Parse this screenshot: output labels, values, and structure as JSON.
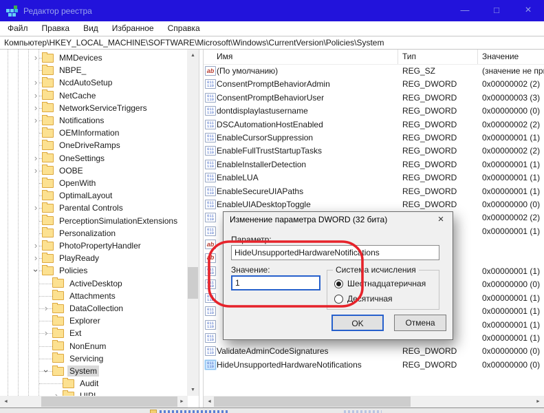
{
  "window": {
    "title": "Редактор реестра",
    "controls": [
      {
        "name": "minimize",
        "glyph": "—"
      },
      {
        "name": "maximize",
        "glyph": "□"
      },
      {
        "name": "close",
        "glyph": "×"
      }
    ]
  },
  "menu": {
    "items": [
      "Файл",
      "Правка",
      "Вид",
      "Избранное",
      "Справка"
    ]
  },
  "address": {
    "value": "Компьютер\\HKEY_LOCAL_MACHINE\\SOFTWARE\\Microsoft\\Windows\\CurrentVersion\\Policies\\System"
  },
  "tree": {
    "items": [
      {
        "label": "MMDevices",
        "level": 0,
        "expander": "collapsed",
        "selected": false
      },
      {
        "label": "NBPE_",
        "level": 0,
        "expander": "none",
        "selected": false
      },
      {
        "label": "NcdAutoSetup",
        "level": 0,
        "expander": "collapsed",
        "selected": false
      },
      {
        "label": "NetCache",
        "level": 0,
        "expander": "collapsed",
        "selected": false
      },
      {
        "label": "NetworkServiceTriggers",
        "level": 0,
        "expander": "collapsed",
        "selected": false
      },
      {
        "label": "Notifications",
        "level": 0,
        "expander": "collapsed",
        "selected": false
      },
      {
        "label": "OEMInformation",
        "level": 0,
        "expander": "none",
        "selected": false
      },
      {
        "label": "OneDriveRamps",
        "level": 0,
        "expander": "none",
        "selected": false
      },
      {
        "label": "OneSettings",
        "level": 0,
        "expander": "collapsed",
        "selected": false
      },
      {
        "label": "OOBE",
        "level": 0,
        "expander": "collapsed",
        "selected": false
      },
      {
        "label": "OpenWith",
        "level": 0,
        "expander": "none",
        "selected": false
      },
      {
        "label": "OptimalLayout",
        "level": 0,
        "expander": "none",
        "selected": false
      },
      {
        "label": "Parental Controls",
        "level": 0,
        "expander": "collapsed",
        "selected": false
      },
      {
        "label": "PerceptionSimulationExtensions",
        "level": 0,
        "expander": "none",
        "selected": false
      },
      {
        "label": "Personalization",
        "level": 0,
        "expander": "none",
        "selected": false
      },
      {
        "label": "PhotoPropertyHandler",
        "level": 0,
        "expander": "collapsed",
        "selected": false
      },
      {
        "label": "PlayReady",
        "level": 0,
        "expander": "collapsed",
        "selected": false
      },
      {
        "label": "Policies",
        "level": 0,
        "expander": "expanded",
        "selected": false
      },
      {
        "label": "ActiveDesktop",
        "level": 1,
        "expander": "none",
        "selected": false
      },
      {
        "label": "Attachments",
        "level": 1,
        "expander": "none",
        "selected": false
      },
      {
        "label": "DataCollection",
        "level": 1,
        "expander": "collapsed",
        "selected": false
      },
      {
        "label": "Explorer",
        "level": 1,
        "expander": "none",
        "selected": false
      },
      {
        "label": "Ext",
        "level": 1,
        "expander": "collapsed",
        "selected": false
      },
      {
        "label": "NonEnum",
        "level": 1,
        "expander": "none",
        "selected": false
      },
      {
        "label": "Servicing",
        "level": 1,
        "expander": "none",
        "selected": false
      },
      {
        "label": "System",
        "level": 1,
        "expander": "expanded",
        "selected": true
      },
      {
        "label": "Audit",
        "level": 2,
        "expander": "none",
        "selected": false
      },
      {
        "label": "UIPI",
        "level": 2,
        "expander": "collapsed",
        "selected": false
      }
    ]
  },
  "list": {
    "columns": [
      "Имя",
      "Тип",
      "Значение"
    ],
    "rows": [
      {
        "icon": "sz",
        "name": "(По умолчанию)",
        "type": "REG_SZ",
        "value": "(значение не присвоено)",
        "selected": false
      },
      {
        "icon": "dword",
        "name": "ConsentPromptBehaviorAdmin",
        "type": "REG_DWORD",
        "value": "0x00000002 (2)",
        "selected": false
      },
      {
        "icon": "dword",
        "name": "ConsentPromptBehaviorUser",
        "type": "REG_DWORD",
        "value": "0x00000003 (3)",
        "selected": false
      },
      {
        "icon": "dword",
        "name": "dontdisplaylastusername",
        "type": "REG_DWORD",
        "value": "0x00000000 (0)",
        "selected": false
      },
      {
        "icon": "dword",
        "name": "DSCAutomationHostEnabled",
        "type": "REG_DWORD",
        "value": "0x00000002 (2)",
        "selected": false
      },
      {
        "icon": "dword",
        "name": "EnableCursorSuppression",
        "type": "REG_DWORD",
        "value": "0x00000001 (1)",
        "selected": false
      },
      {
        "icon": "dword",
        "name": "EnableFullTrustStartupTasks",
        "type": "REG_DWORD",
        "value": "0x00000002 (2)",
        "selected": false
      },
      {
        "icon": "dword",
        "name": "EnableInstallerDetection",
        "type": "REG_DWORD",
        "value": "0x00000001 (1)",
        "selected": false
      },
      {
        "icon": "dword",
        "name": "EnableLUA",
        "type": "REG_DWORD",
        "value": "0x00000001 (1)",
        "selected": false
      },
      {
        "icon": "dword",
        "name": "EnableSecureUIAPaths",
        "type": "REG_DWORD",
        "value": "0x00000001 (1)",
        "selected": false
      },
      {
        "icon": "dword",
        "name": "EnableUIADesktopToggle",
        "type": "REG_DWORD",
        "value": "0x00000000 (0)",
        "selected": false
      },
      {
        "icon": "dword",
        "name": "",
        "type": "",
        "value": "0x00000002 (2)",
        "selected": false
      },
      {
        "icon": "dword",
        "name": "",
        "type": "",
        "value": "0x00000001 (1)",
        "selected": false
      },
      {
        "icon": "sz",
        "name": "",
        "type": "",
        "value": "",
        "selected": false
      },
      {
        "icon": "sz",
        "name": "",
        "type": "",
        "value": "",
        "selected": false
      },
      {
        "icon": "dword",
        "name": "",
        "type": "",
        "value": "0x00000001 (1)",
        "selected": false
      },
      {
        "icon": "dword",
        "name": "",
        "type": "",
        "value": "0x00000000 (0)",
        "selected": false
      },
      {
        "icon": "dword",
        "name": "",
        "type": "",
        "value": "0x00000001 (1)",
        "selected": false
      },
      {
        "icon": "dword",
        "name": "",
        "type": "",
        "value": "0x00000001 (1)",
        "selected": false
      },
      {
        "icon": "dword",
        "name": "",
        "type": "",
        "value": "0x00000001 (1)",
        "selected": false
      },
      {
        "icon": "dword",
        "name": "",
        "type": "",
        "value": "0x00000001 (1)",
        "selected": false
      },
      {
        "icon": "dword",
        "name": "ValidateAdminCodeSignatures",
        "type": "REG_DWORD",
        "value": "0x00000000 (0)",
        "selected": false
      },
      {
        "icon": "dword",
        "name": "HideUnsupportedHardwareNotifications",
        "type": "REG_DWORD",
        "value": "0x00000000 (0)",
        "selected": true
      }
    ]
  },
  "dialog": {
    "title": "Изменение параметра DWORD (32 бита)",
    "close_glyph": "×",
    "param_label": "Параметр:",
    "param_value": "HideUnsupportedHardwareNotifications",
    "value_label": "Значение:",
    "value_text": "1",
    "group_label": "Система исчисления",
    "radios": [
      {
        "label": "Шестнадцатеричная",
        "selected": true
      },
      {
        "label": "Десятичная",
        "selected": false
      }
    ],
    "ok_label": "OK",
    "cancel_label": "Отмена"
  },
  "icons": {
    "sz_glyph": "ab",
    "dword_glyph_top": "011",
    "dword_glyph_bottom": "110",
    "chevron": "›",
    "scroll_up": "▲",
    "scroll_down": "▼",
    "scroll_left": "◄",
    "scroll_right": "►"
  },
  "colors": {
    "titlebar": "#2213db",
    "annotation": "#e6232b",
    "focus_blue": "#2660cc",
    "tree_selection": "#d9d9d9"
  }
}
